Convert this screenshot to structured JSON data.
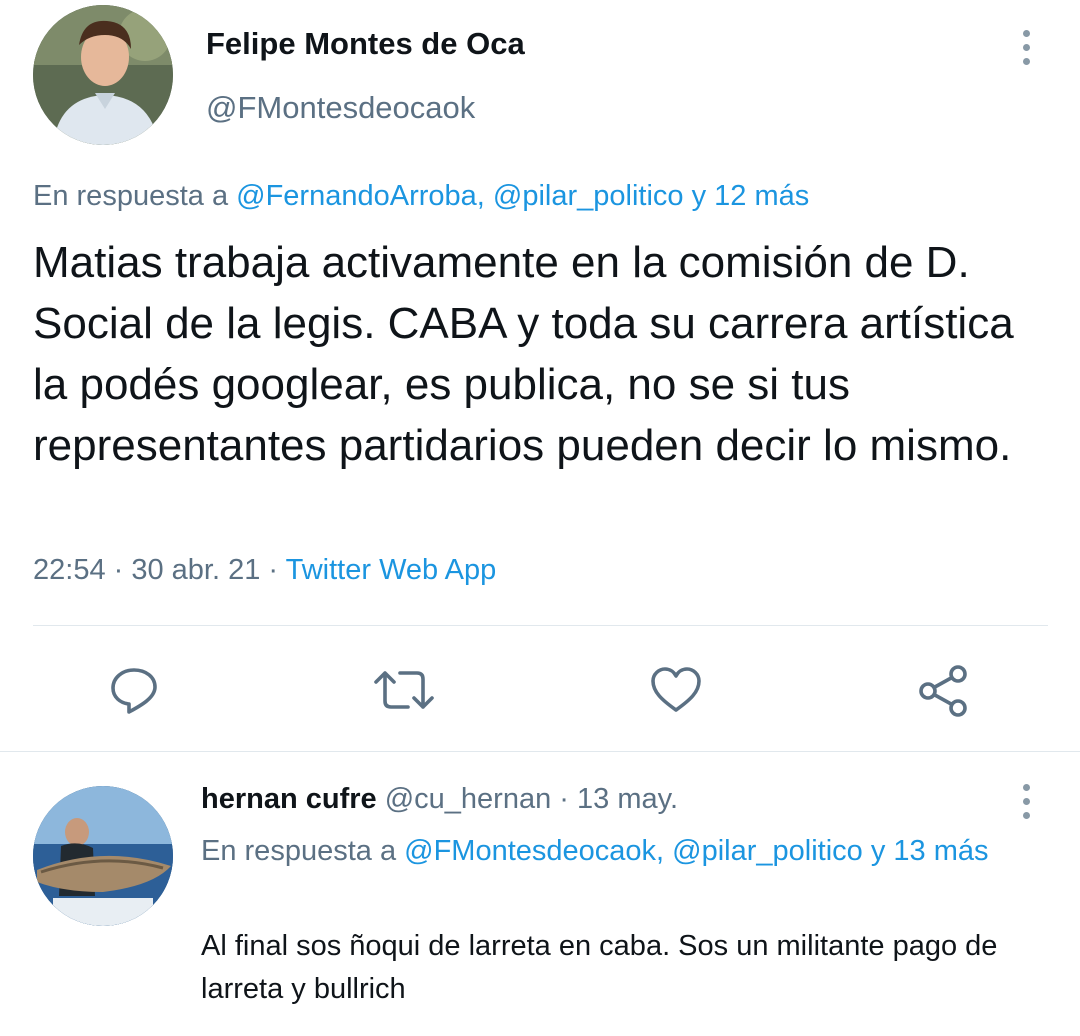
{
  "main_tweet": {
    "author_name": "Felipe Montes de Oca",
    "author_handle": "@FMontesdeocaok",
    "reply_prefix": "En respuesta a ",
    "reply_mentions": "@FernandoArroba, @pilar_politico y 12 más",
    "text": "Matias trabaja activamente en la comisión de D. Social de la legis. CABA y toda su carrera artística la podés googlear, es publica, no se si tus representantes partidarios pueden decir lo mismo.",
    "time": "22:54",
    "sep1": " · ",
    "date": "30 abr. 21",
    "sep2": " · ",
    "source": "Twitter Web App"
  },
  "actions": {
    "icons": [
      "reply-icon",
      "retweet-icon",
      "like-icon",
      "share-icon"
    ]
  },
  "reply_tweet": {
    "author_name": "hernan cufre",
    "author_handle": "@cu_hernan",
    "sep": " · ",
    "date": "13 may.",
    "reply_prefix": "En respuesta a ",
    "reply_mentions": "@FMontesdeocaok, @pilar_politico y 13 más",
    "text": "Al final sos ñoqui de larreta en caba. Sos un militante pago de larreta y bullrich"
  },
  "colors": {
    "link": "#1b95e0",
    "secondary_text": "#5b7083",
    "icon": "#5b7083"
  }
}
